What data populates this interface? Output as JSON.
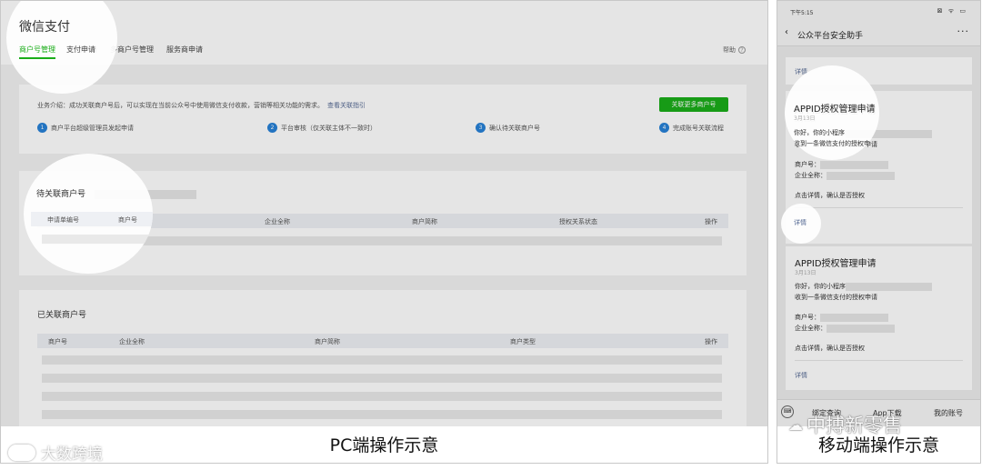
{
  "pc": {
    "brand": "微信支付",
    "tabs": [
      "商户号管理",
      "支付申请",
      "多商户号管理",
      "服务商申请"
    ],
    "help": "帮助",
    "intro": {
      "text": "业务介绍：成功关联商户号后，可以实现在当前公众号中使用微信支付收款，营销等相关功能的需求。",
      "link": "查看关联指引",
      "button": "关联更多商户号"
    },
    "steps": [
      {
        "num": "1",
        "label": "商户平台超级管理员发起申请"
      },
      {
        "num": "2",
        "label": "平台审核（仅关联主体不一致时）"
      },
      {
        "num": "3",
        "label": "确认待关联商户号"
      },
      {
        "num": "4",
        "label": "完成账号关联流程"
      }
    ],
    "pending": {
      "title": "待关联商户号",
      "columns": [
        "申请单编号",
        "商户号",
        "企业全称",
        "商户简称",
        "授权关系状态",
        "操作"
      ]
    },
    "linked": {
      "title": "已关联商户号",
      "columns": [
        "商户号",
        "企业全称",
        "商户简称",
        "商户类型",
        "操作"
      ]
    },
    "caption": "PC端操作示意"
  },
  "mobile": {
    "time": "下午5:15",
    "status_icons": "⊠ ᯤ ▭",
    "nav_back": "‹",
    "nav_title": "公众平台安全助手",
    "nav_more": "···",
    "top_detail": "详情",
    "cards": [
      {
        "title": "APPID授权管理申请",
        "date": "3月13日",
        "greeting": "你好，你的小程序",
        "line2": "收到一条微信支付的授权申请",
        "merchant_label": "商户号：",
        "company_label": "企业全称：",
        "confirm": "点击详情，确认是否授权",
        "detail": "详情"
      },
      {
        "title": "APPID授权管理申请",
        "date": "3月13日",
        "greeting": "你好，你的小程序",
        "line2": "收到一条微信支付的授权申请",
        "merchant_label": "商户号：",
        "company_label": "企业全称：",
        "confirm": "点击详情，确认是否授权",
        "detail": "详情"
      }
    ],
    "bottom": {
      "keyboard": "⌨",
      "items": [
        "绑定查询",
        "App下载",
        "我的账号"
      ]
    },
    "caption": "移动端操作示意"
  },
  "watermarks": {
    "left": "大数跨境",
    "right": "中搏新零售",
    "right_icon": "☁"
  },
  "colors": {
    "accent_green": "#1aad19",
    "step_blue": "#2782d7",
    "link_blue": "#576b95"
  }
}
